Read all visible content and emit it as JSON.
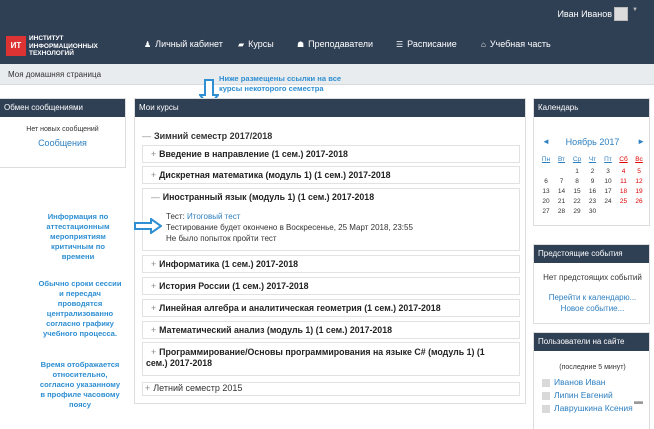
{
  "header": {
    "user_name": "Иван Иванов",
    "logo_badge": "ИТ",
    "logo_lines": [
      "ИНСТИТУТ",
      "ИНФОРМАЦИОННЫХ",
      "ТЕХНОЛОГИЙ"
    ],
    "nav": [
      {
        "label": "Личный кабинет",
        "icon": "person-icon"
      },
      {
        "label": "Курсы",
        "icon": "book-icon"
      },
      {
        "label": "Преподаватели",
        "icon": "group-icon"
      },
      {
        "label": "Расписание",
        "icon": "list-icon"
      },
      {
        "label": "Учебная часть",
        "icon": "building-icon"
      }
    ]
  },
  "breadcrumb": "Моя домашняя страница",
  "annotations": {
    "top_note": [
      "Ниже размещены ссылки на все",
      "курсы некоторого семестра"
    ],
    "left_notes": [
      [
        "Информация по",
        "аттестационным",
        "мероприятиям",
        "критичным по",
        "времени"
      ],
      [
        "Обычно сроки сессии",
        "и пересдач",
        "проводятся",
        "централизованно",
        "согласно графику",
        "учебного процесса."
      ],
      [
        "Время отображается",
        "относительно,",
        "согласно указанному",
        "в профиле часовому",
        "поясу"
      ]
    ]
  },
  "messages": {
    "title": "Обмен сообщениями",
    "empty": "Нет новых сообщений",
    "link": "Сообщения"
  },
  "courses": {
    "title": "Мои курсы",
    "semester1": "Зимний семестр 2017/2018",
    "items": [
      "Введение в направление (1 сем.) 2017-2018",
      "Дискретная математика (модуль 1) (1 сем.) 2017-2018",
      "Иностранный язык (модуль 1) (1 сем.) 2017-2018",
      "Информатика (1 сем.) 2017-2018",
      "История России (1 сем.) 2017-2018",
      "Линейная алгебра и аналитическая геометрия (1 сем.) 2017-2018",
      "Математический анализ (модуль 1) (1 сем.) 2017-2018",
      "Программирование/Основы программирования на языке C# (модуль 1) (1",
      "сем.) 2017-2018"
    ],
    "quiz_prefix": "Тест:",
    "quiz_link": "Итоговый тест",
    "quiz_deadline": "Тестирование будет окончено в Воскресенье, 25 Март 2018, 23:55",
    "quiz_status": "Не было попыток пройти тест",
    "semester2": "Летний семестр 2015"
  },
  "calendar": {
    "title": "Календарь",
    "prev": "◄",
    "next": "►",
    "month": "Ноябрь 2017",
    "weekdays": [
      "Пн",
      "Вт",
      "Ср",
      "Чт",
      "Пт",
      "Сб",
      "Вс"
    ],
    "weeks": [
      [
        "",
        "",
        "1",
        "2",
        "3",
        "4",
        "5"
      ],
      [
        "6",
        "7",
        "8",
        "9",
        "10",
        "11",
        "12"
      ],
      [
        "13",
        "14",
        "15",
        "16",
        "17",
        "18",
        "19"
      ],
      [
        "20",
        "21",
        "22",
        "23",
        "24",
        "25",
        "26"
      ],
      [
        "27",
        "28",
        "29",
        "30",
        "",
        "",
        ""
      ]
    ]
  },
  "events": {
    "title": "Предстоящие события",
    "none": "Нет предстоящих событий",
    "goto": "Перейти к календарю...",
    "new": "Новое событие..."
  },
  "online": {
    "title": "Пользователи на сайте",
    "period": "(последние 5 минут)",
    "users": [
      "Иванов Иван",
      "Липин Евгений",
      "Лаврушкина Ксения"
    ]
  }
}
